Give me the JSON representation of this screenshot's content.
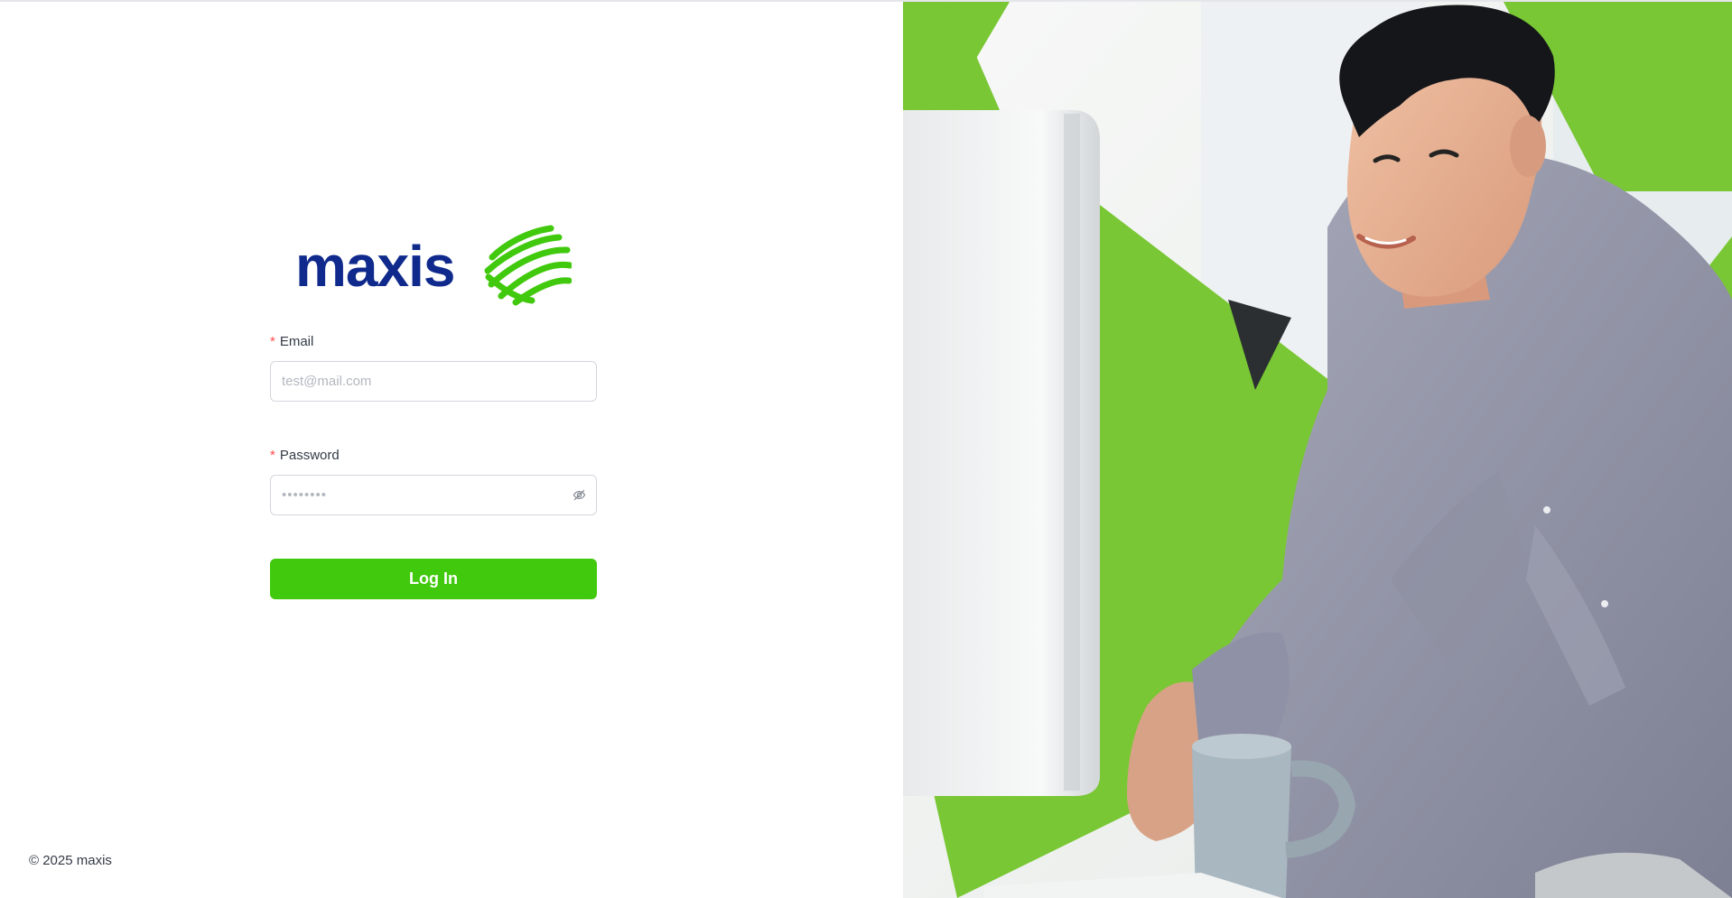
{
  "brand": {
    "logo_text": "maxis",
    "logo_color": "#0f2a8c",
    "accent_color": "#41c90d"
  },
  "login_form": {
    "email": {
      "label": "Email",
      "required_mark": "*",
      "placeholder": "test@mail.com",
      "value": ""
    },
    "password": {
      "label": "Password",
      "required_mark": "*",
      "placeholder": "••••••••",
      "value": "",
      "toggle_icon": "eye-slash-icon"
    },
    "submit_label": "Log In"
  },
  "footer": {
    "copyright": "© 2025 maxis"
  },
  "hero": {
    "image_subject": "man smiling at computer with green brand shapes"
  }
}
